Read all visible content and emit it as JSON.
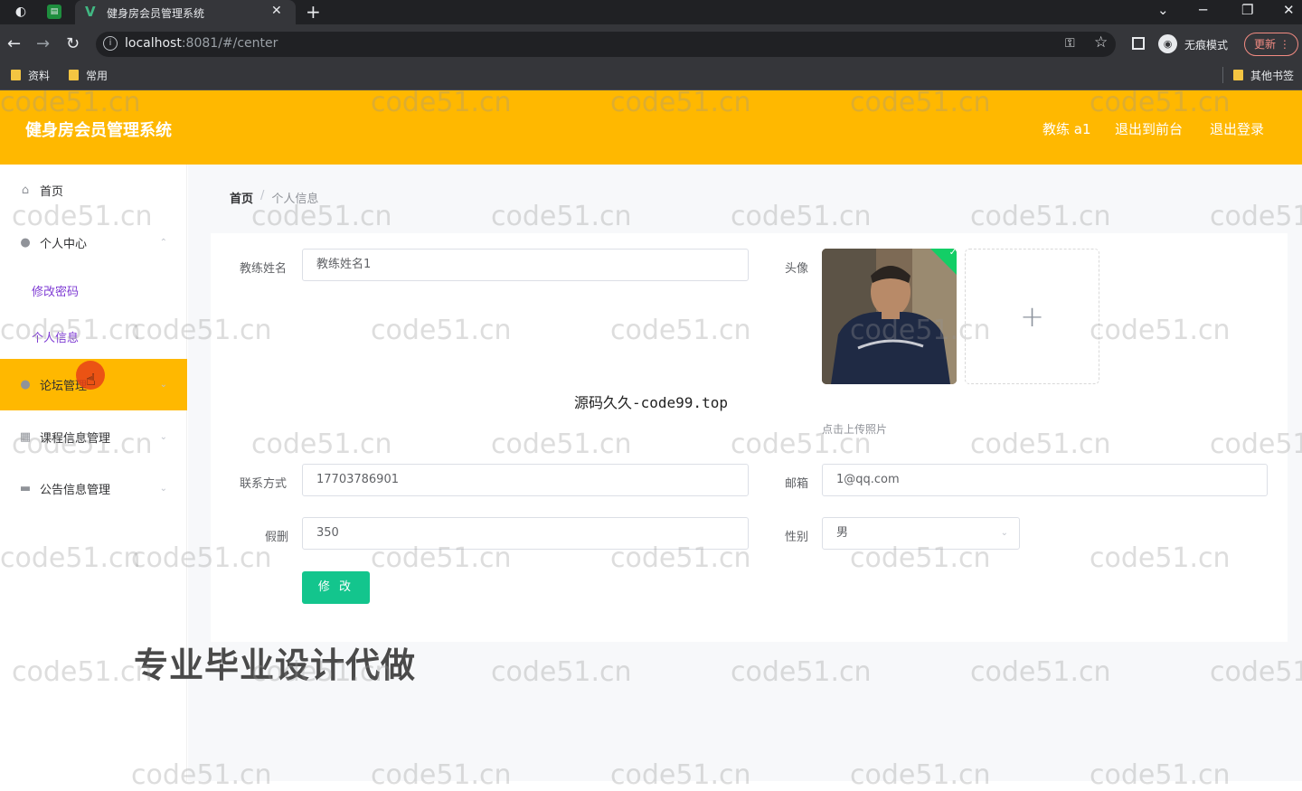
{
  "browser": {
    "tab_title": "健身房会员管理系统",
    "url_host": "localhost",
    "url_rest": ":8081/#/center",
    "incognito_label": "无痕模式",
    "update_label": "更新",
    "bookmarks": [
      "资料",
      "常用"
    ],
    "other_bookmarks": "其他书签"
  },
  "header": {
    "title": "健身房会员管理系统",
    "user_label": "教练 a1",
    "to_front": "退出到前台",
    "logout": "退出登录"
  },
  "sidebar": {
    "home": "首页",
    "personal_center": "个人中心",
    "change_password": "修改密码",
    "personal_info": "个人信息",
    "forum": "论坛管理",
    "course": "课程信息管理",
    "notice": "公告信息管理"
  },
  "breadcrumb": {
    "home": "首页",
    "separator": "/",
    "current": "个人信息"
  },
  "form": {
    "name_label": "教练姓名",
    "name_value": "教练姓名1",
    "avatar_label": "头像",
    "upload_tip": "点击上传照片",
    "phone_label": "联系方式",
    "phone_value": "17703786901",
    "email_label": "邮箱",
    "email_value": "1@qq.com",
    "leave_label": "假删",
    "leave_value": "350",
    "gender_label": "性别",
    "gender_value": "男",
    "submit_label": "修 改"
  },
  "overlays": {
    "source_caption": "源码久久-code99.top",
    "promo": "专业毕业设计代做",
    "watermark": "code51.cn"
  },
  "colors": {
    "accent": "#ffb800",
    "submit": "#13c58d",
    "submenu_text": "#7f3cd4"
  }
}
